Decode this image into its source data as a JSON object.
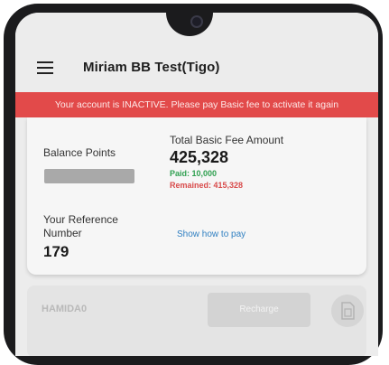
{
  "header": {
    "title": "Miriam BB Test(Tigo)"
  },
  "banner": {
    "message": "Your account is INACTIVE. Please pay Basic fee to activate it again"
  },
  "account_card": {
    "balance_points_label": "Balance Points",
    "total_fee_label": "Total Basic Fee Amount",
    "total_fee_value": "425,328",
    "paid_text": "Paid: 10,000",
    "remained_text": "Remained: 415,328",
    "reference_label": "Your Reference Number",
    "reference_value": "179",
    "show_how_to_pay": "Show how to pay"
  },
  "recharge_card": {
    "code": "HAMIDA0",
    "recharge_label": "Recharge"
  },
  "colors": {
    "banner": "#e24a4a",
    "paid": "#2fa050",
    "remained": "#d84a4a",
    "link": "#2f7fc1"
  },
  "icons": {
    "menu": "menu-icon",
    "sim": "sim-card-icon"
  }
}
